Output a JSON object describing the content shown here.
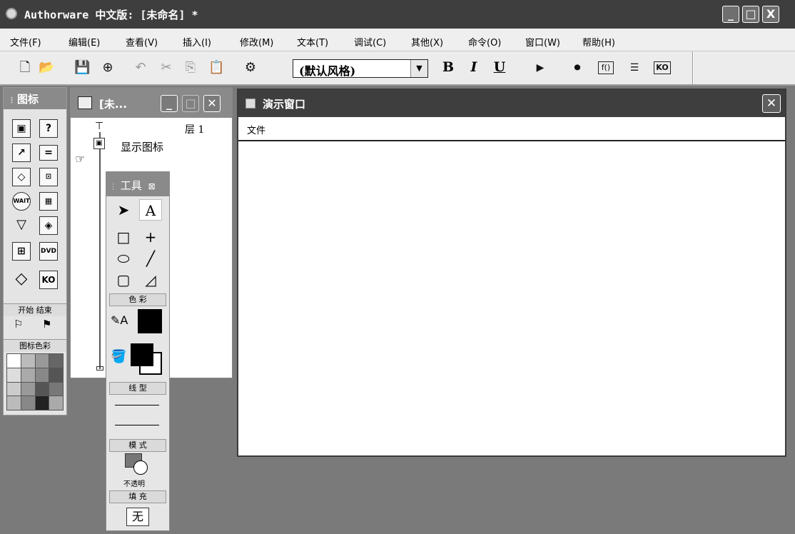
{
  "app": {
    "title": "Authorware 中文版: [未命名] *",
    "window_buttons": {
      "minimize": "_",
      "maximize": "□",
      "close": "X"
    }
  },
  "menu": {
    "items": [
      {
        "label": "文件(F)"
      },
      {
        "label": "编辑(E)"
      },
      {
        "label": "查看(V)"
      },
      {
        "label": "插入(I)"
      },
      {
        "label": "修改(M)"
      },
      {
        "label": "文本(T)"
      },
      {
        "label": "调试(C)"
      },
      {
        "label": "其他(X)"
      },
      {
        "label": "命令(O)"
      },
      {
        "label": "窗口(W)"
      },
      {
        "label": "帮助(H)"
      }
    ]
  },
  "toolbar": {
    "style_combo": "(默认风格)",
    "bold": "B",
    "italic": "I",
    "underline": "U",
    "icon_names": [
      "new-icon",
      "open-icon",
      "save-all-icon",
      "import-icon",
      "undo-icon",
      "cut-icon",
      "copy-icon",
      "paste-icon",
      "find-icon",
      "run-icon",
      "control-panel-icon",
      "functions-icon",
      "variables-icon",
      "knowledge-objects-icon"
    ]
  },
  "icon_palette": {
    "title": "图标",
    "start_end_label": "开始 结束",
    "color_label": "图标色彩",
    "icon_names": [
      "display-icon",
      "motion-icon",
      "erase-icon",
      "wait-icon",
      "navigate-icon",
      "framework-icon",
      "decision-icon",
      "interaction-icon",
      "calculation-icon",
      "map-icon",
      "digital-movie-icon",
      "sound-icon",
      "video-icon",
      "knowledge-object-icon"
    ]
  },
  "flowline_window": {
    "title": "[未...",
    "layer": "层 1",
    "display_icon_label": "显示图标"
  },
  "tools_palette": {
    "title": "工具",
    "color_section": "色 彩",
    "line_section": "线 型",
    "mode_section": "模 式",
    "mode_value": "不透明",
    "fill_section": "填 充",
    "fill_value": "无",
    "text_tool": "A"
  },
  "presentation_window": {
    "title": "演示窗口",
    "menu_item": "文件"
  },
  "colors": {
    "titlebar": "#3e3e3e",
    "workspace": "#7a7a7a"
  }
}
